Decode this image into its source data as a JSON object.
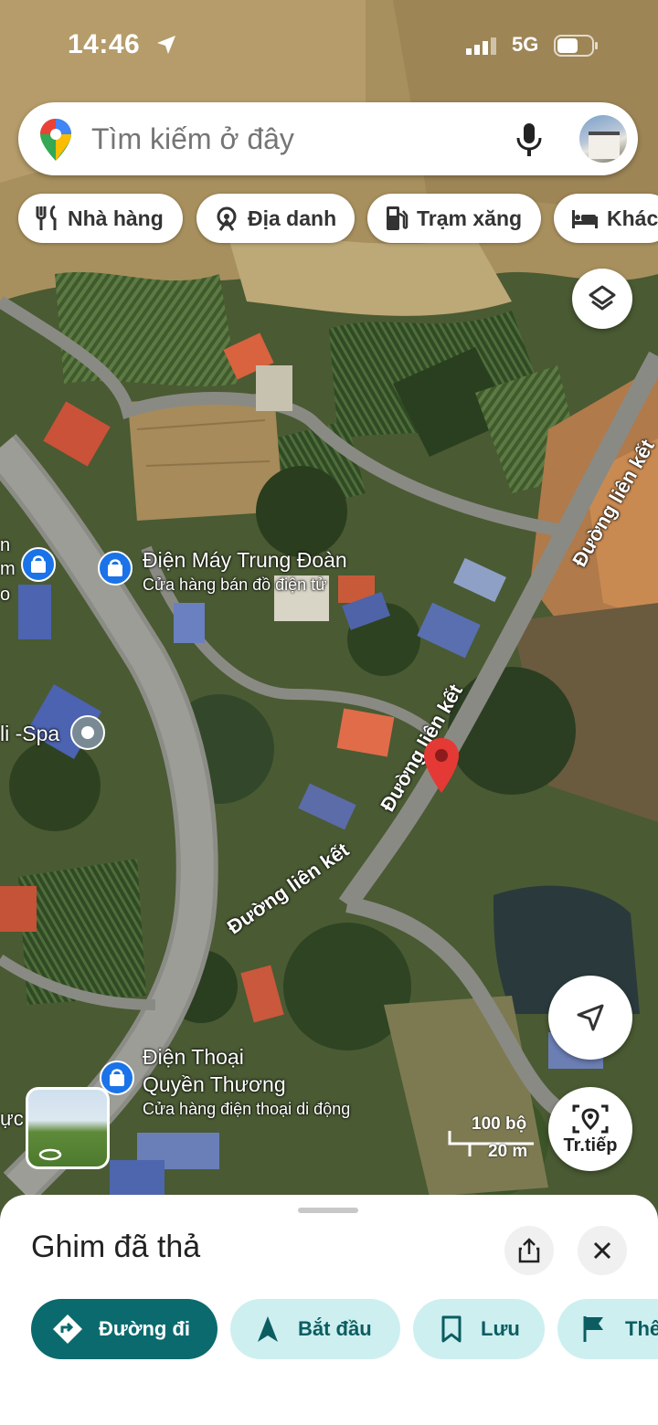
{
  "status": {
    "time": "14:46",
    "network": "5G"
  },
  "search": {
    "placeholder": "Tìm kiếm ở đây"
  },
  "chips": [
    {
      "label": "Nhà hàng",
      "icon": "fork-knife-icon"
    },
    {
      "label": "Địa danh",
      "icon": "landmark-icon"
    },
    {
      "label": "Trạm xăng",
      "icon": "gas-station-icon"
    },
    {
      "label": "Khác",
      "icon": "bed-icon"
    }
  ],
  "map": {
    "roads": [
      "Đường liên kết",
      "Đường liên kết",
      "Đường liên kết"
    ],
    "pois": [
      {
        "name": "Điện Máy Trung Đoàn",
        "category": "Cửa hàng bán đồ điện tử"
      },
      {
        "name": "Điện Thoại",
        "name2": "Quyền Thương",
        "category": "Cửa hàng điện thoại di động"
      },
      {
        "name": "li -Spa"
      }
    ],
    "partial_labels": [
      "n",
      "m",
      "o",
      "ực"
    ],
    "scale": {
      "top": "100 bộ",
      "bottom": "20 m"
    },
    "live_view_label": "Tr.tiếp"
  },
  "sheet": {
    "title": "Ghim đã thả",
    "actions": [
      {
        "label": "Đường đi",
        "icon": "directions-icon"
      },
      {
        "label": "Bắt đầu",
        "icon": "navigation-arrow-icon"
      },
      {
        "label": "Lưu",
        "icon": "bookmark-icon"
      },
      {
        "label": "Thê",
        "icon": "flag-icon"
      }
    ]
  },
  "colors": {
    "accent": "#0b6a6e",
    "secondary": "#cdeff0",
    "pin": "#e53935",
    "poi": "#1a73e8"
  }
}
